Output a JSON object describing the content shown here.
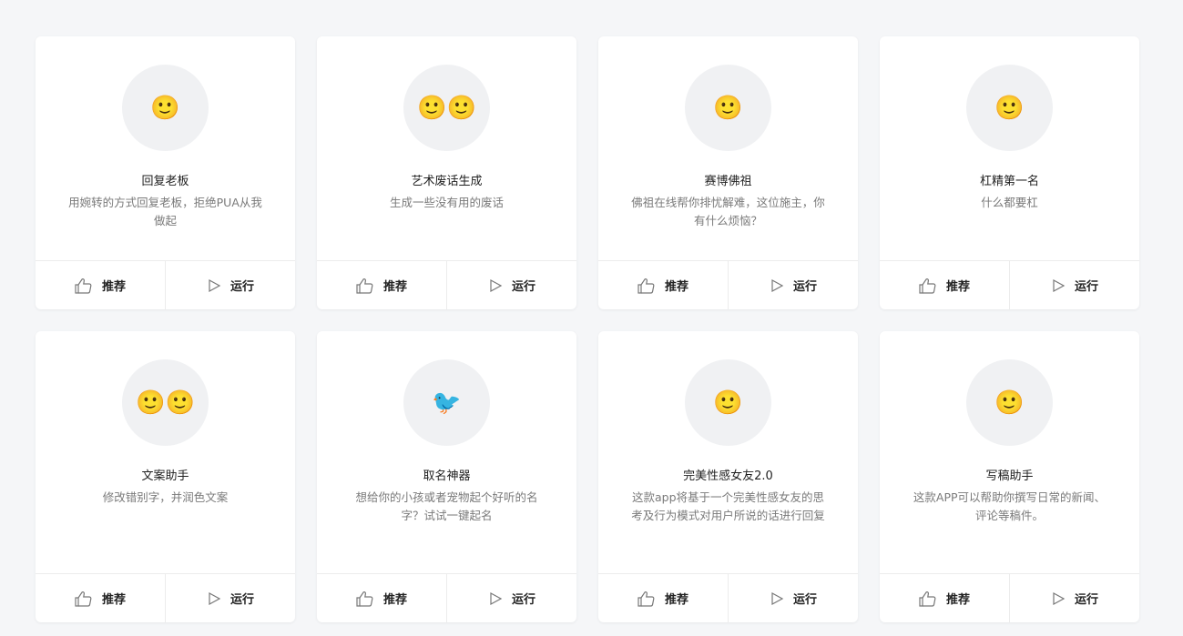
{
  "actions": {
    "recommend_label": "推荐",
    "run_label": "运行",
    "recommend_icon": "thumbs-up-icon",
    "run_icon": "play-icon"
  },
  "cards": [
    {
      "emoji": "🙂",
      "title": "回复老板",
      "desc": "用婉转的方式回复老板，拒绝PUA从我做起"
    },
    {
      "emoji": "🙂🙂",
      "title": "艺术废话生成",
      "desc": "生成一些没有用的废话"
    },
    {
      "emoji": "🙂",
      "title": "赛博佛祖",
      "desc": "佛祖在线帮你排忧解难，这位施主，你有什么烦恼？"
    },
    {
      "emoji": "🙂",
      "title": "杠精第一名",
      "desc": "什么都要杠"
    },
    {
      "emoji": "🙂🙂",
      "title": "文案助手",
      "desc": "修改错别字，并润色文案"
    },
    {
      "emoji": "🐦",
      "title": "取名神器",
      "desc": "想给你的小孩或者宠物起个好听的名字？试试一键起名"
    },
    {
      "emoji": "🙂",
      "title": "完美性感女友2.0",
      "desc": "这款app将基于一个完美性感女友的思考及行为模式对用户所说的话进行回复"
    },
    {
      "emoji": "🙂",
      "title": "写稿助手",
      "desc": "这款APP可以帮助你撰写日常的新闻、评论等稿件。"
    }
  ]
}
